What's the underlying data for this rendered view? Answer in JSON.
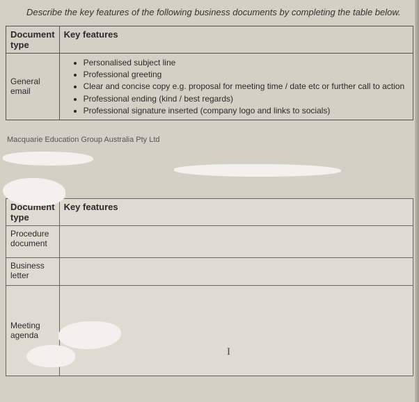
{
  "instruction": "Describe the key features of the following business documents by completing the table below.",
  "table1": {
    "header_doctype": "Document type",
    "header_features": "Key features",
    "row": {
      "doctype": "General email",
      "features": [
        "Personalised subject line",
        "Professional greeting",
        "Clear and concise copy e.g. proposal for meeting time / date etc or further call to action",
        "Professional ending (kind / best regards)",
        "Professional signature inserted (company logo and links to socials)"
      ]
    }
  },
  "footer": "Macquarie Education Group Australia Pty Ltd",
  "table2": {
    "header_doctype": "Document type",
    "header_features": "Key features",
    "rows": [
      {
        "doctype": "Procedure document",
        "features": ""
      },
      {
        "doctype": "Business letter",
        "features": ""
      },
      {
        "doctype": "Meeting agenda",
        "features": ""
      }
    ]
  },
  "cursor_glyph": "I"
}
